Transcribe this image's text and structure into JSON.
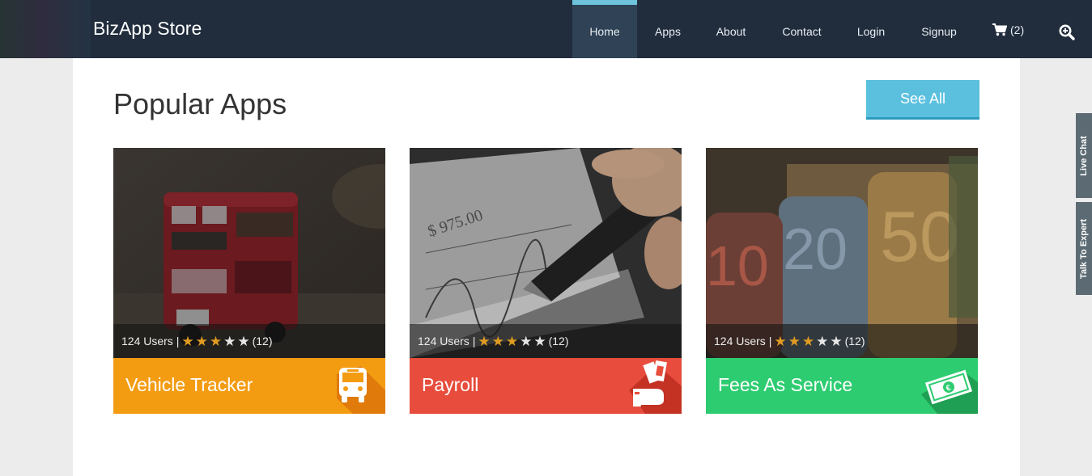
{
  "brand": "BizApp Store",
  "nav": {
    "items": [
      "Home",
      "Apps",
      "About",
      "Contact",
      "Login",
      "Signup"
    ],
    "active": "Home",
    "cart_count": "(2)",
    "cart_icon": "shopping-cart-icon",
    "search_icon": "zoom-in-icon"
  },
  "main": {
    "title": "Popular Apps",
    "see_all": "See All"
  },
  "apps": [
    {
      "name": "Vehicle Tracker",
      "users": "124 Users |",
      "rating": 3,
      "max_rating": 5,
      "reviews": "(12)",
      "color": "#f39c12",
      "shadow": "#e07a0b",
      "icon": "bus-icon"
    },
    {
      "name": "Payroll",
      "users": "124 Users |",
      "rating": 3,
      "max_rating": 5,
      "reviews": "(12)",
      "color": "#e74c3c",
      "shadow": "#c43224",
      "icon": "hand-with-money-icon"
    },
    {
      "name": "Fees As Service",
      "users": "124 Users |",
      "rating": 3,
      "max_rating": 5,
      "reviews": "(12)",
      "color": "#2ecc71",
      "shadow": "#1f9f53",
      "icon": "banknote-icon"
    }
  ],
  "side_tabs": [
    "Live Chat",
    "Talk To Expert"
  ],
  "colors": {
    "navbar": "#212d3d",
    "accent": "#5bc0de",
    "star_on": "#e09b22"
  }
}
